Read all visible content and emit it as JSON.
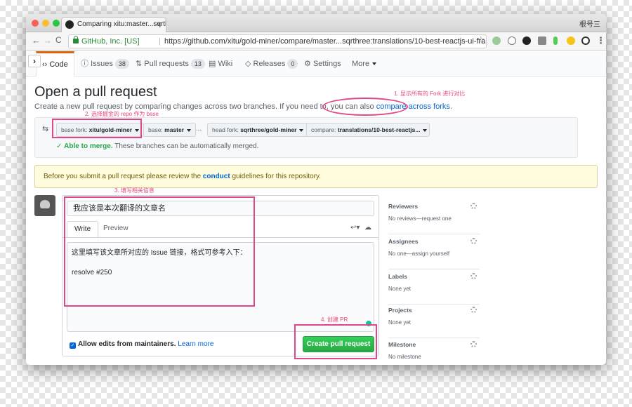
{
  "browser": {
    "tab_title": "Comparing xitu:master...sqrthr",
    "tab_close": "×",
    "user": "根号三",
    "secure_label": "GitHub, Inc. [US]",
    "url": "https://github.com/xitu/gold-miner/compare/master...sqrthree:translations/10-best-reactjs-ui-frameworks-for-ra...",
    "back": "←",
    "forward": "→",
    "reload": "C",
    "star": "☆",
    "menu": "⋮"
  },
  "repo_tabs": [
    {
      "label": "Code",
      "icon": "‹›"
    },
    {
      "label": "Issues",
      "count": "38"
    },
    {
      "label": "Pull requests",
      "count": "13"
    },
    {
      "label": "Wiki"
    },
    {
      "label": "Releases",
      "count": "0"
    },
    {
      "label": "Settings"
    },
    {
      "label": "More"
    }
  ],
  "sidebar_toggle": "›",
  "page": {
    "title": "Open a pull request",
    "subtitle_pre": "Create a new pull request by comparing changes across two branches. If you need to, you can also ",
    "subtitle_link": "compare across forks",
    "subtitle_post": "."
  },
  "annotations": {
    "a1": "1. 显示所有的 Fork 进行对比",
    "a2": "2. 选择掘金的 repo 作为 base",
    "a3": "3. 填写相关信息",
    "a4": "4. 创建 PR"
  },
  "range": {
    "base_fork_label": "base fork:",
    "base_fork": "xitu/gold-miner",
    "base_label": "base:",
    "base": "master",
    "ellipsis": "...",
    "head_fork_label": "head fork:",
    "head_fork": "sqrthree/gold-miner",
    "compare_label": "compare:",
    "compare": "translations/10-best-reactjs...",
    "merge_bold": "Able to merge.",
    "merge_text": " These branches can be automatically merged."
  },
  "flash": {
    "pre": "Before you submit a pull request please review the ",
    "link": "conduct",
    "post": " guidelines for this repository."
  },
  "form": {
    "title_value": "我应该是本次翻译的文章名",
    "tab_write": "Write",
    "tab_preview": "Preview",
    "body_line1": "这里填写该文章所对应的 Issue 链接，格式可参考入下：",
    "body_line2": "resolve #250",
    "allow_edits": "Allow edits from maintainers.",
    "learn_more": "Learn more",
    "create_button": "Create pull request"
  },
  "sidebar": [
    {
      "title": "Reviewers",
      "value": "No reviews—request one"
    },
    {
      "title": "Assignees",
      "value": "No one—assign yourself"
    },
    {
      "title": "Labels",
      "value": "None yet"
    },
    {
      "title": "Projects",
      "value": "None yet"
    },
    {
      "title": "Milestone",
      "value": "No milestone"
    }
  ],
  "colors": {
    "accent": "#28a745",
    "link": "#0366d6",
    "annotation": "#e0478a"
  }
}
